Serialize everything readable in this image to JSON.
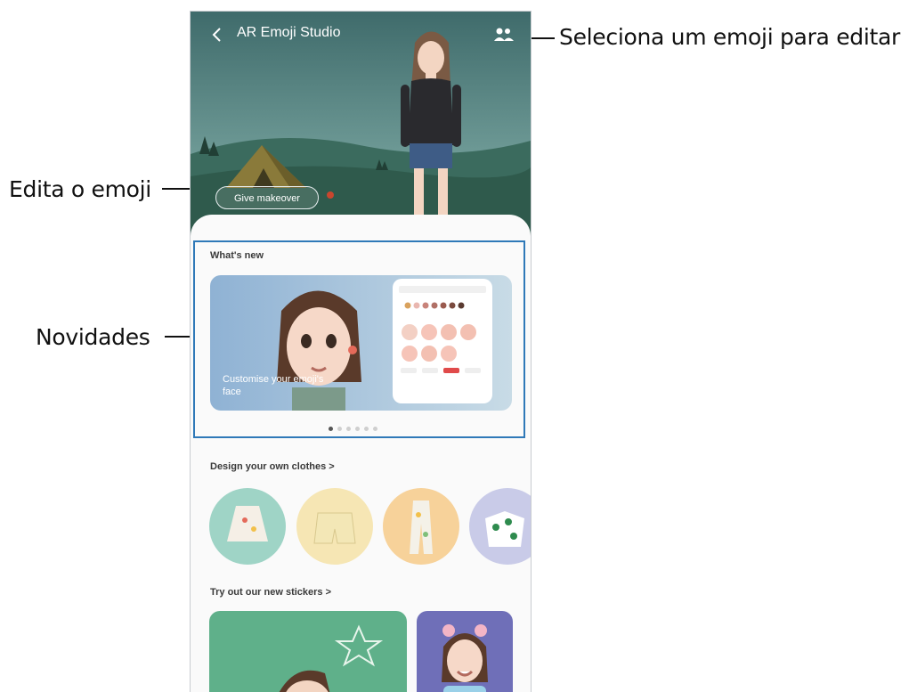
{
  "annotations": {
    "select_emoji": "Seleciona um emoji para editar",
    "edit_emoji": "Edita o emoji",
    "whats_new": "Novidades"
  },
  "app": {
    "title": "AR Emoji Studio",
    "back_icon": "chevron-left-icon",
    "switch_emoji_icon": "people-icon"
  },
  "hero": {
    "makeover_label": "Give makeover"
  },
  "whats_new": {
    "title": "What's new",
    "banner_caption": "Customise your emoji's face",
    "page_count": 6,
    "active_page": 1
  },
  "clothes": {
    "title": "Design your own clothes  >"
  },
  "stickers": {
    "title": "Try out our new stickers  >"
  },
  "colors": {
    "callout_border": "#2f79b8",
    "hero_sky": "#4f7a78",
    "hero_ground": "#2f5a4c"
  }
}
